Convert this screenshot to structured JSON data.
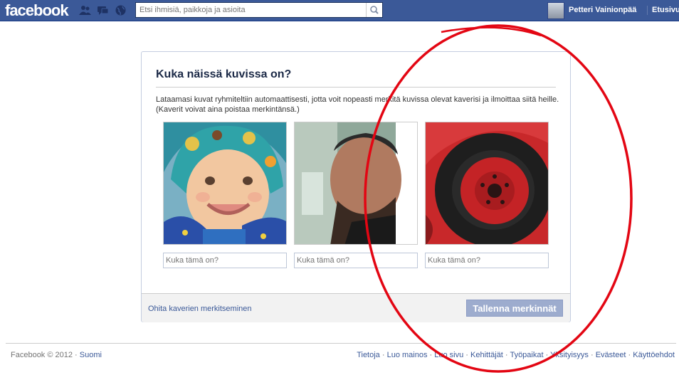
{
  "topbar": {
    "logo": "facebook",
    "search_placeholder": "Etsi ihmisiä, paikkoja ja asioita",
    "user_name": "Petteri Vainionpää",
    "home_label": "Etusivu",
    "icons": [
      "friend-requests-icon",
      "messages-icon",
      "notifications-globe-icon",
      "search-icon"
    ]
  },
  "dialog": {
    "title": "Kuka näissä kuvissa on?",
    "intro": "Lataamasi kuvat ryhmiteltiin automaattisesti, jotta voit nopeasti merkitä kuvissa olevat kaverisi ja ilmoittaa siitä heille. (Kaverit voivat aina poistaa merkintänsä.)",
    "photos": [
      {
        "subject": "baby in a patterned hat",
        "input_placeholder": "Kuka tämä on?"
      },
      {
        "subject": "man looking down",
        "input_placeholder": "Kuka tämä on?"
      },
      {
        "subject": "red car wheel",
        "input_placeholder": "Kuka tämä on?"
      }
    ],
    "skip_link": "Ohita kaverien merkitseminen",
    "save_button": "Tallenna merkinnät"
  },
  "footer": {
    "copyright": "Facebook © 2012 ·",
    "language": "Suomi",
    "links": [
      "Tietoja",
      "Luo mainos",
      "Luo sivu",
      "Kehittäjät",
      "Työpaikat",
      "Yksityisyys",
      "Evästeet",
      "Käyttöehdot"
    ]
  },
  "colors": {
    "brand_blue": "#3b5998",
    "annotation_red": "#e30613",
    "button_disabled": "#9dacce"
  }
}
